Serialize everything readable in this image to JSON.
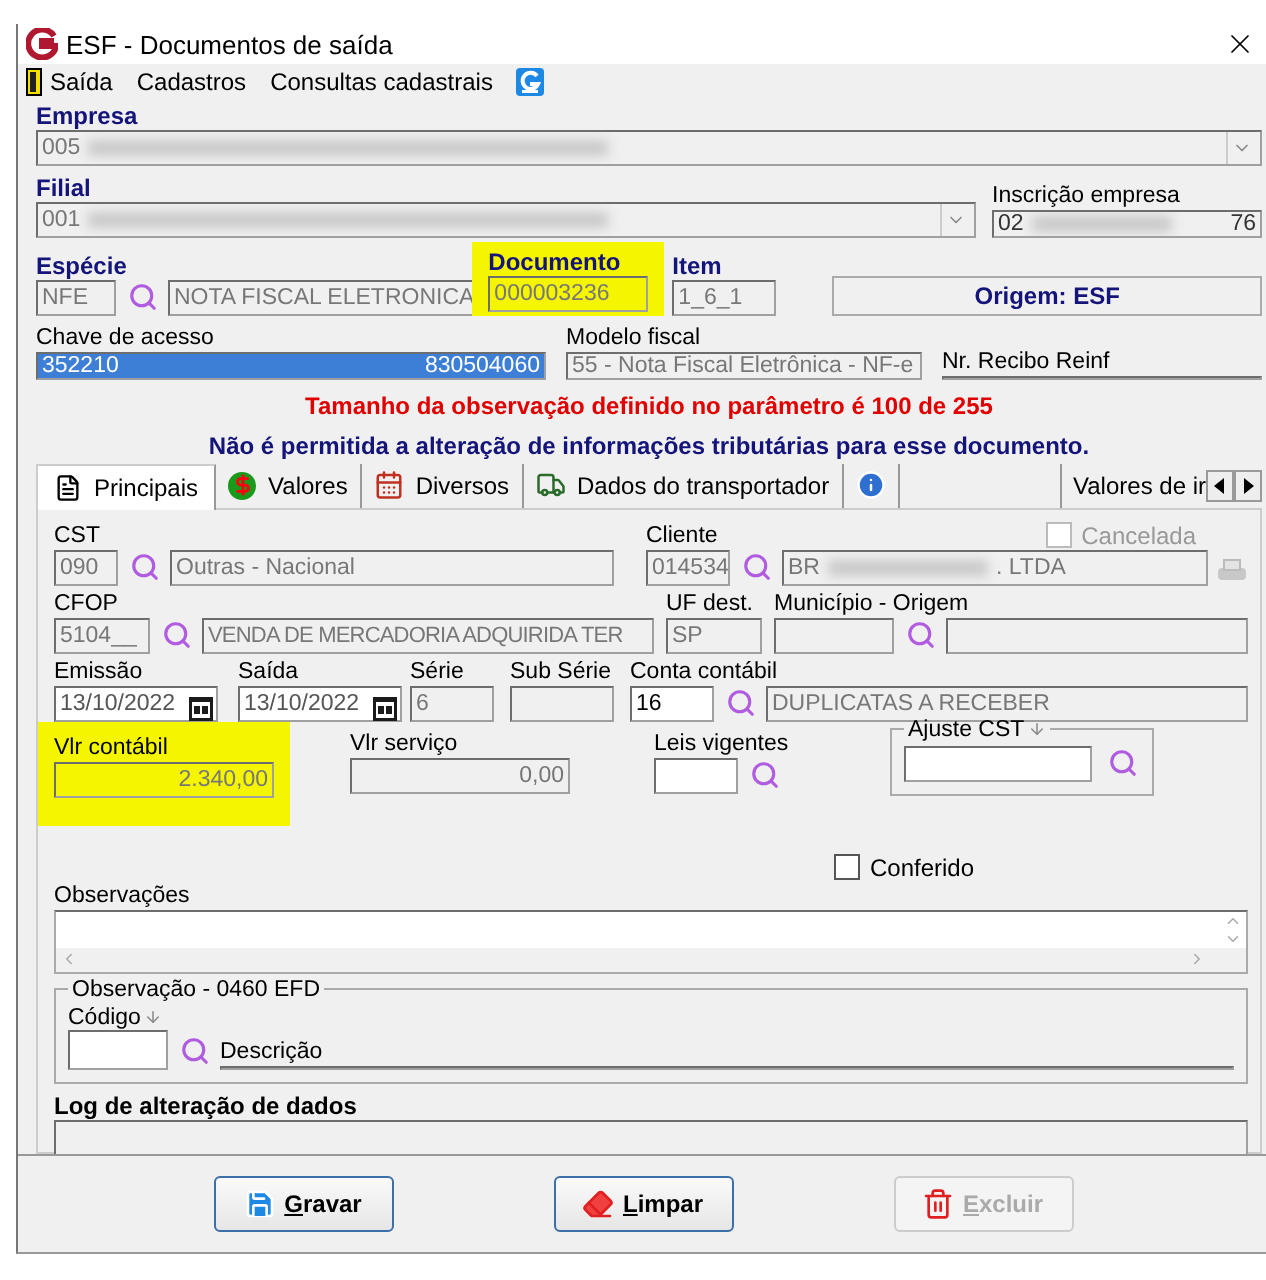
{
  "window": {
    "title": "ESF - Documentos de saída"
  },
  "menu": [
    {
      "kind": "exit",
      "label": "Saída"
    },
    {
      "kind": "text",
      "label": "Cadastros"
    },
    {
      "kind": "text",
      "label": "Consultas cadastrais"
    },
    {
      "kind": "logo"
    }
  ],
  "empresa": {
    "label": "Empresa",
    "value": "005"
  },
  "filial": {
    "label": "Filial",
    "value": "001"
  },
  "inscricao": {
    "label": "Inscrição empresa",
    "value_start": "02",
    "value_end": "76"
  },
  "especie": {
    "label": "Espécie",
    "code": "NFE",
    "description": "NOTA FISCAL ELETRONICA"
  },
  "documento": {
    "label": "Documento",
    "value": "000003236",
    "highlighted": true
  },
  "item": {
    "label": "Item",
    "value": "1_6_1"
  },
  "origem": "Origem: ESF",
  "chave": {
    "label": "Chave de acesso",
    "value_start": "352210",
    "value_end": "830504060",
    "selected": true
  },
  "modelo": {
    "label": "Modelo fiscal",
    "value": "55 - Nota Fiscal Eletrônica - NF-e"
  },
  "recibo": {
    "label": "Nr. Recibo Reinf"
  },
  "messages": [
    {
      "kind": "warning",
      "text": "Tamanho da observação definido no parâmetro é 100 de 255"
    },
    {
      "kind": "info",
      "text": "Não é permitida a alteração de informações tributárias para esse documento."
    }
  ],
  "tabs": [
    {
      "kind": "document",
      "label": "Principais",
      "selected": true
    },
    {
      "kind": "money",
      "label": "Valores",
      "selected": false
    },
    {
      "kind": "calendar",
      "label": "Diversos",
      "selected": false
    },
    {
      "kind": "truck",
      "label": "Dados do transportador",
      "selected": false
    },
    {
      "kind": "info",
      "selected": false
    },
    {
      "kind": "text",
      "label": "Valores de ir",
      "selected": false
    }
  ],
  "cst": {
    "label": "CST",
    "code": "090",
    "description": "Outras - Nacional"
  },
  "cliente": {
    "label": "Cliente",
    "code": "014534",
    "description_start": "BR",
    "description_end": ". LTDA"
  },
  "cancelada": {
    "label": "Cancelada",
    "checked": false,
    "disabled": true
  },
  "cfop": {
    "label": "CFOP",
    "code": "5104__",
    "description": "VENDA DE MERCADORIA ADQUIRIDA TER"
  },
  "uf_dest": {
    "label": "UF dest.",
    "value": "SP"
  },
  "municipio": {
    "label": "Município - Origem"
  },
  "emissao": {
    "label": "Emissão",
    "value": "13/10/2022"
  },
  "saida": {
    "label": "Saída",
    "value": "13/10/2022"
  },
  "serie": {
    "label": "Série",
    "value": "6"
  },
  "sub_serie": {
    "label": "Sub Série"
  },
  "conta_contabil": {
    "label": "Conta contábil",
    "code": "16",
    "description": "DUPLICATAS A RECEBER"
  },
  "vlr_contabil": {
    "label": "Vlr contábil",
    "value": "2.340,00",
    "highlighted": true
  },
  "vlr_servico": {
    "label": "Vlr serviço",
    "value": "0,00"
  },
  "leis_vigentes": {
    "label": "Leis vigentes"
  },
  "ajuste_cst": {
    "label": "Ajuste CST"
  },
  "conferido": {
    "label": "Conferido",
    "checked": false
  },
  "observacoes": {
    "label": "Observações"
  },
  "observacao_efd": {
    "title": "Observação - 0460 EFD",
    "codigo_label": "Código",
    "descricao_label": "Descrição"
  },
  "log": {
    "label": "Log de alteração de dados"
  },
  "buttons": [
    {
      "kind": "save",
      "label": "Gravar",
      "disabled": false
    },
    {
      "kind": "clear",
      "label": "Limpar",
      "disabled": false
    },
    {
      "kind": "delete",
      "label": "Excluir",
      "disabled": true
    }
  ]
}
